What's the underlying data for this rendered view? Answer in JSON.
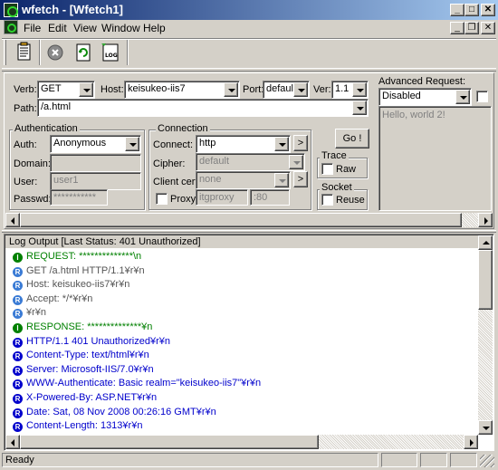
{
  "window": {
    "title": "wfetch - [Wfetch1]"
  },
  "menu": [
    "File",
    "Edit",
    "View",
    "Window",
    "Help"
  ],
  "toolbar": {
    "icons": [
      "new-document-icon",
      "stop-icon",
      "refresh-icon",
      "log-icon"
    ],
    "log_icon_text": "LOG"
  },
  "request": {
    "verb_label": "Verb:",
    "verb": "GET",
    "host_label": "Host:",
    "host": "keisukeo-iis7",
    "port_label": "Port:",
    "port": "default",
    "ver_label": "Ver:",
    "ver": "1.1",
    "path_label": "Path:",
    "path": "/a.html"
  },
  "advanced": {
    "label": "Advanced Request:",
    "value": "Disabled",
    "body": "Hello, world 2!"
  },
  "auth": {
    "title": "Authentication",
    "auth_label": "Auth:",
    "auth": "Anonymous",
    "domain_label": "Domain:",
    "domain": "",
    "user_label": "User:",
    "user": "user1",
    "passwd_label": "Passwd:",
    "passwd": "***********"
  },
  "connection": {
    "title": "Connection",
    "connect_label": "Connect:",
    "connect": "http",
    "cipher_label": "Cipher:",
    "cipher": "default",
    "clientcert_label": "Client cert:",
    "clientcert": "none",
    "proxy_label": "Proxy:",
    "proxy": "itgproxy",
    "proxy_port": ":80",
    "arrow": ">"
  },
  "go_label": "Go !",
  "trace": {
    "title": "Trace",
    "raw_label": "Raw"
  },
  "socket": {
    "title": "Socket",
    "reuse_label": "Reuse"
  },
  "log": {
    "title": "Log Output [Last Status: 401 Unauthorized]",
    "lines": [
      {
        "badge": "I",
        "text": "REQUEST: **************\\n",
        "color": "#008000"
      },
      {
        "badge": "R",
        "text": "GET /a.html HTTP/1.1¥r¥n",
        "color": "#555555"
      },
      {
        "badge": "R",
        "text": "Host: keisukeo-iis7¥r¥n",
        "color": "#555555"
      },
      {
        "badge": "R",
        "text": "Accept: */*¥r¥n",
        "color": "#555555"
      },
      {
        "badge": "R",
        "text": "¥r¥n",
        "color": "#555555"
      },
      {
        "badge": "I",
        "text": "RESPONSE: **************¥n",
        "color": "#008000"
      },
      {
        "badge": "R",
        "text": "HTTP/1.1 401 Unauthorized¥r¥n",
        "color": "#0000cc"
      },
      {
        "badge": "R",
        "text": "Content-Type: text/html¥r¥n",
        "color": "#0000cc"
      },
      {
        "badge": "R",
        "text": "Server: Microsoft-IIS/7.0¥r¥n",
        "color": "#0000cc"
      },
      {
        "badge": "R",
        "text": "WWW-Authenticate: Basic realm=\"keisukeo-iis7\"¥r¥n",
        "color": "#0000cc"
      },
      {
        "badge": "R",
        "text": "X-Powered-By: ASP.NET¥r¥n",
        "color": "#0000cc"
      },
      {
        "badge": "R",
        "text": "Date: Sat, 08 Nov 2008 00:26:16 GMT¥r¥n",
        "color": "#0000cc"
      },
      {
        "badge": "R",
        "text": "Content-Length: 1313¥r¥n",
        "color": "#0000cc"
      }
    ]
  },
  "status": {
    "text": "Ready"
  },
  "colors": {
    "face": "#d4d0c8",
    "title_start": "#0a246a",
    "title_end": "#a6caf0",
    "info_badge": "#008000",
    "req_badge": "#3a7bd5",
    "resp_badge": "#0000cc"
  }
}
